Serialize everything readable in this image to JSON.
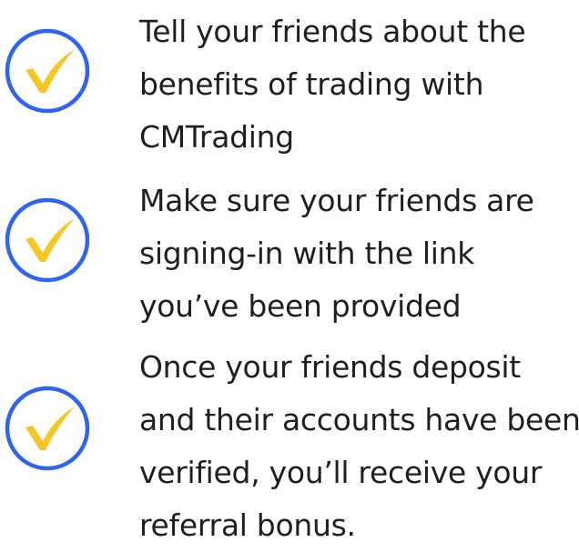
{
  "colors": {
    "ring": "#2f63f2",
    "check": "#f6c625",
    "text": "#1f1f1f"
  },
  "icon": "check-circle-icon",
  "steps": [
    {
      "lines": [
        "Tell your friends about the",
        "benefits of trading with",
        "CMTrading"
      ]
    },
    {
      "lines": [
        "Make sure your friends are",
        "signing-in with the link",
        "you’ve been provided"
      ]
    },
    {
      "lines": [
        "Once your friends deposit",
        "and their accounts have been",
        "verified, you’ll receive your",
        "referral bonus."
      ]
    }
  ]
}
